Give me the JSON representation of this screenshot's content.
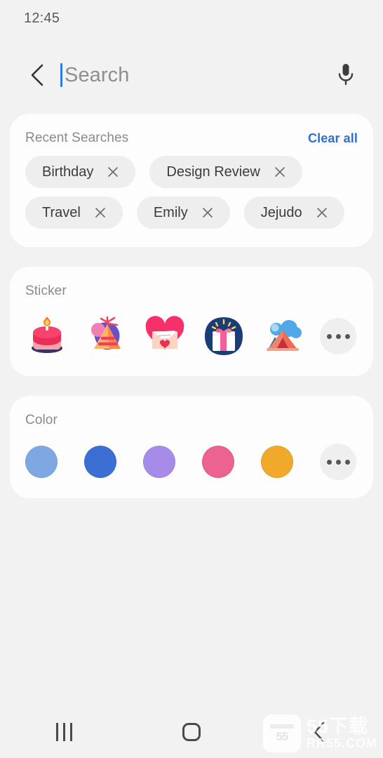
{
  "status": {
    "time": "12:45"
  },
  "search": {
    "back_icon": "chevron-left-icon",
    "placeholder": "Search",
    "value": "",
    "mic_icon": "microphone-icon"
  },
  "recent": {
    "title": "Recent Searches",
    "clear_all": "Clear all",
    "chips": [
      {
        "label": "Birthday",
        "remove_icon": "close-icon"
      },
      {
        "label": "Design Review",
        "remove_icon": "close-icon"
      },
      {
        "label": "Travel",
        "remove_icon": "close-icon"
      },
      {
        "label": "Emily",
        "remove_icon": "close-icon"
      },
      {
        "label": "Jejudo",
        "remove_icon": "close-icon"
      }
    ]
  },
  "sticker": {
    "title": "Sticker",
    "items": [
      {
        "name": "birthday-cake-sticker"
      },
      {
        "name": "party-hat-sticker"
      },
      {
        "name": "love-letter-sticker"
      },
      {
        "name": "gift-box-sticker"
      },
      {
        "name": "mountain-tent-sticker"
      }
    ],
    "more_icon": "more-horizontal-icon"
  },
  "color": {
    "title": "Color",
    "items": [
      {
        "name": "light-blue",
        "hex": "#7FA8E3"
      },
      {
        "name": "blue",
        "hex": "#3B6FD4"
      },
      {
        "name": "purple",
        "hex": "#A68CE8"
      },
      {
        "name": "pink",
        "hex": "#EC6391"
      },
      {
        "name": "orange",
        "hex": "#F0A92B"
      }
    ],
    "more_icon": "more-horizontal-icon"
  },
  "navbar": {
    "recents_icon": "recents-icon",
    "home_icon": "home-icon",
    "back_icon": "chevron-left-icon"
  },
  "watermark": {
    "logo_text": "55",
    "title": "55下载",
    "url": "RR55.COM"
  },
  "theme": {
    "page_bg": "#F2F2F2",
    "card_bg": "#FDFDFD",
    "chip_bg": "#EEEEEE",
    "accent_blue": "#2F6FD0",
    "caret_blue": "#2F7DE1",
    "muted_text": "#8A8A8A"
  }
}
